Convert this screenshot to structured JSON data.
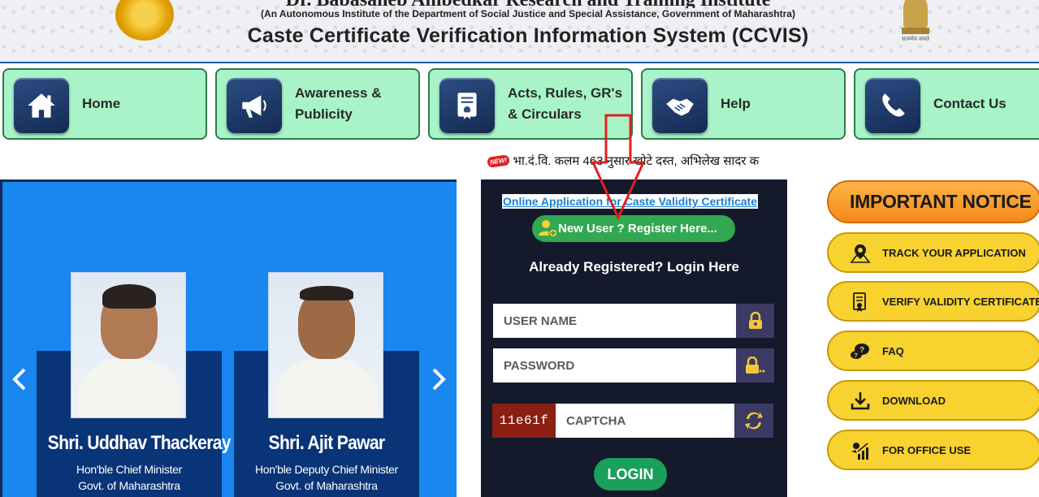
{
  "header": {
    "org_name": "Dr. Babasaheb Ambedkar Research and Training Institute",
    "org_subtitle": "(An Autonomous Institute of the Department of Social Justice and Special Assistance, Government of Maharashtra)",
    "app_title": "Caste Certificate Verification Information System (CCVIS)",
    "emblem_motto": "सत्यमेव जयते"
  },
  "nav": {
    "items": [
      {
        "label": "Home",
        "icon": "home-icon"
      },
      {
        "label": "Awareness &\nPublicity",
        "icon": "megaphone-icon"
      },
      {
        "label": "Acts, Rules, GR's\n& Circulars",
        "icon": "certificate-icon"
      },
      {
        "label": "Help",
        "icon": "handshake-icon"
      },
      {
        "label": "Contact Us",
        "icon": "phone-icon"
      }
    ]
  },
  "ticker": {
    "badge": "NEW!",
    "text": "भा.दं.वि. कलम 463 नुसार खोटे दस्त, अभिलेख सादर क"
  },
  "slider": {
    "prev_icon": "chevron-left-icon",
    "next_icon": "chevron-right-icon",
    "persons": [
      {
        "name": "Shri. Uddhav Thackeray",
        "role": "Hon'ble Chief Minister",
        "org": "Govt. of Maharashtra"
      },
      {
        "name": "Shri. Ajit Pawar",
        "role": "Hon'ble Deputy Chief Minister",
        "org": "Govt. of Maharashtra"
      }
    ]
  },
  "login": {
    "online_application_link": "Online Application for Caste Validity Certificate",
    "register_label": "New User ? Register Here...",
    "already_registered": "Already Registered? Login Here",
    "username_placeholder": "USER NAME",
    "password_placeholder": "PASSWORD",
    "captcha_code": "11e61f",
    "captcha_placeholder": "CAPTCHA",
    "login_label": "LOGIN"
  },
  "sidebar": {
    "notice_label": "IMPORTANT NOTICE",
    "items": [
      {
        "label": "TRACK YOUR APPLICATION",
        "icon": "track-icon"
      },
      {
        "label": "VERIFY VALIDITY CERTIFICATE",
        "icon": "verify-certificate-icon"
      },
      {
        "label": "FAQ",
        "icon": "faq-icon"
      },
      {
        "label": "DOWNLOAD",
        "icon": "download-icon"
      },
      {
        "label": "FOR OFFICE USE",
        "icon": "office-chart-icon"
      }
    ]
  },
  "colors": {
    "nav_bg": "#a8f4c8",
    "slider_bg": "#1a86f0",
    "login_panel_bg": "#141a2c",
    "notice_orange": "#f38a1a",
    "side_yellow": "#f8d22e",
    "register_green": "#33a852",
    "captcha_red": "#8a1f12",
    "annotation_red": "#e02020"
  }
}
